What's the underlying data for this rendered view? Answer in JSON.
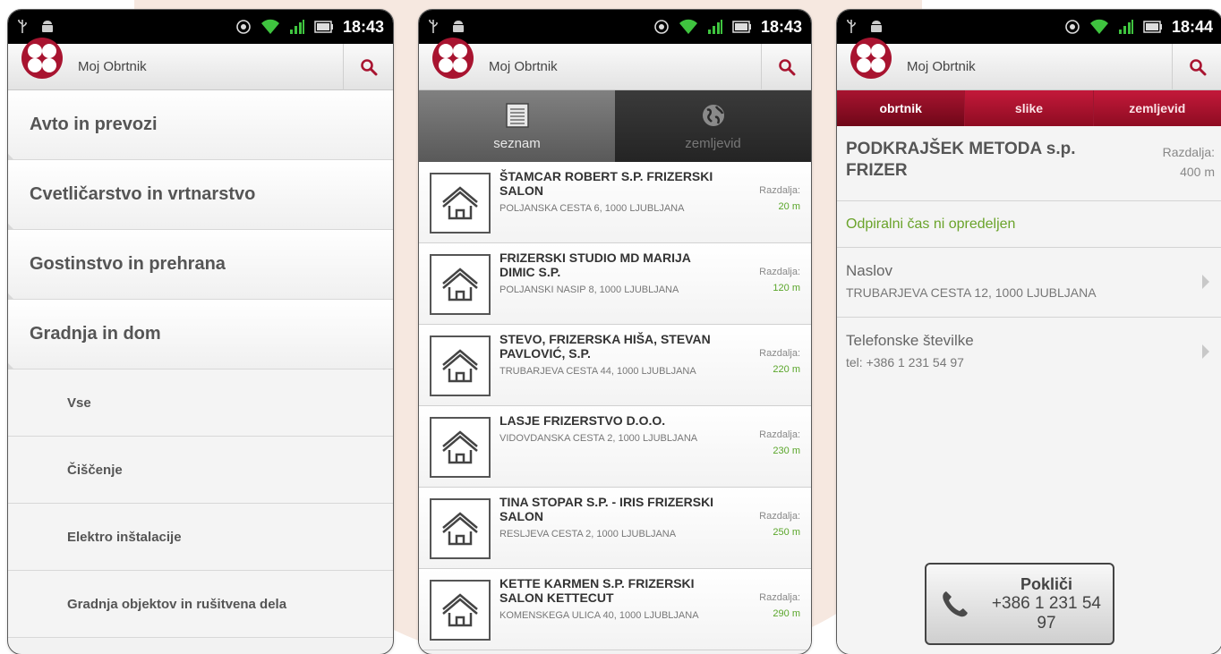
{
  "status_bar": {
    "phone1_time": "18:43",
    "phone2_time": "18:43",
    "phone3_time": "18:44"
  },
  "app": {
    "title": "Moj Obrtnik",
    "search_icon": "search-icon",
    "logo_icon": "logo-icon",
    "brand_color": "#a81430"
  },
  "categories": {
    "items": [
      "Avto in prevozi",
      "Cvetličarstvo in vrtnarstvo",
      "Gostinstvo in prehrana",
      "Gradnja in dom"
    ],
    "subitems": [
      "Vse",
      "Čiščenje",
      "Elektro inštalacije",
      "Gradnja objektov in rušitvena dela"
    ]
  },
  "list_tabs": {
    "list_label": "seznam",
    "map_label": "zemljevid"
  },
  "results": [
    {
      "name": "ŠTAMCAR ROBERT S.P. FRIZERSKI SALON",
      "address": "POLJANSKA CESTA 6, 1000 LJUBLJANA",
      "distance_label": "Razdalja:",
      "distance": "20 m"
    },
    {
      "name": "FRIZERSKI STUDIO MD MARIJA DIMIC s.p.",
      "address": "POLJANSKI NASIP 8, 1000 LJUBLJANA",
      "distance_label": "Razdalja:",
      "distance": "120 m"
    },
    {
      "name": "STEVO, FRIZERSKA HIŠA, STEVAN PAVLOVIĆ, S.P.",
      "address": "TRUBARJEVA CESTA 44, 1000 LJUBLJANA",
      "distance_label": "Razdalja:",
      "distance": "220 m"
    },
    {
      "name": "LASJE FRIZERSTVO d.o.o.",
      "address": "VIDOVDANSKA CESTA 2, 1000 LJUBLJANA",
      "distance_label": "Razdalja:",
      "distance": "230 m"
    },
    {
      "name": "TINA STOPAR S.P. - IRIS FRIZERSKI SALON",
      "address": "RESLJEVA CESTA 2, 1000 LJUBLJANA",
      "distance_label": "Razdalja:",
      "distance": "250 m"
    },
    {
      "name": "KETTE KARMEN s.p. FRIZERSKI SALON KETTECUT",
      "address": "KOMENSKEGA ULICA 40, 1000 LJUBLJANA",
      "distance_label": "Razdalja:",
      "distance": "290 m"
    }
  ],
  "detail": {
    "tabs": [
      "obrtnik",
      "slike",
      "zemljevid"
    ],
    "business_name": "PODKRAJŠEK METODA s.p. FRIZER",
    "distance_label": "Razdalja:",
    "distance": "400 m",
    "hours_text": "Odpiralni čas ni opredeljen",
    "address_title": "Naslov",
    "address_value": "TRUBARJEVA CESTA 12, 1000 LJUBLJANA",
    "phone_title": "Telefonske številke",
    "phone_value": "tel: +386 1 231 54 97",
    "call_label": "Pokliči",
    "call_number": "+386 1 231 54 97"
  }
}
